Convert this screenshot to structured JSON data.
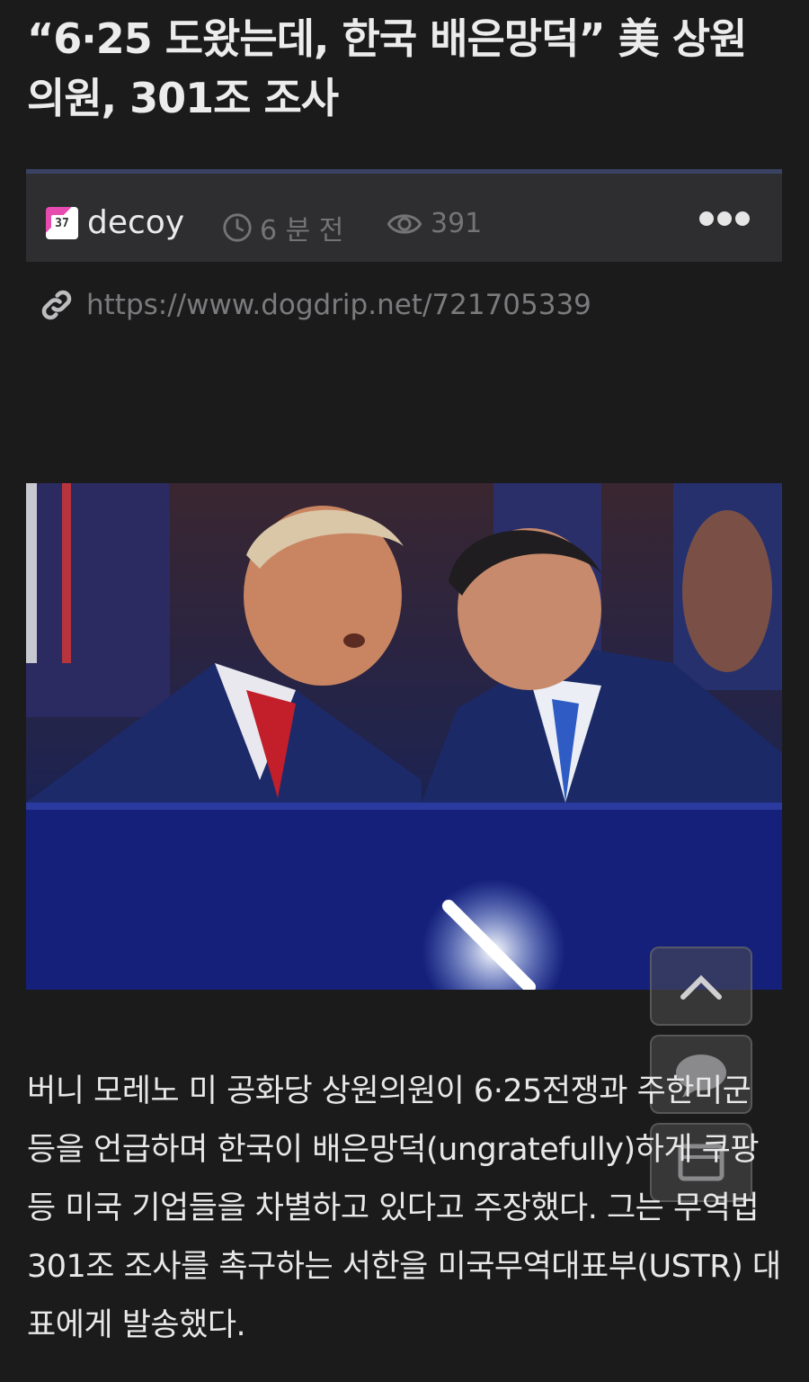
{
  "post": {
    "title": "“6·25 도왔는데, 한국 배은망덕” 美 상원의원, 301조 조사",
    "author": "decoy",
    "author_badge": "37",
    "time_ago": "6 분 전",
    "views": "391",
    "url": "https://www.dogdrip.net/721705339",
    "body": "버니 모레노 미 공화당 상원의원이 6·25전쟁과 주한미군 등을 언급하며 한국이 배은망덕(ungratefully)하게 쿠팡 등 미국 기업들을 차별하고 있다고 주장했다. 그는 무역법 301조 조사를 촉구하는 서한을 미국무역대표부(USTR) 대표에게 발송했다."
  },
  "icons": {
    "time": "clock-icon",
    "views": "eye-icon",
    "link": "link-icon",
    "more": "more-dots-icon",
    "scroll_top": "chevron-up-icon",
    "comments": "comment-bubble-icon",
    "third_float": "box-icon"
  },
  "colors": {
    "background": "#1b1b1c",
    "meta_bar": "#2e2e30",
    "meta_accent": "#3a4263",
    "muted_text": "#747477",
    "badge_pink": "#e84bb0"
  }
}
